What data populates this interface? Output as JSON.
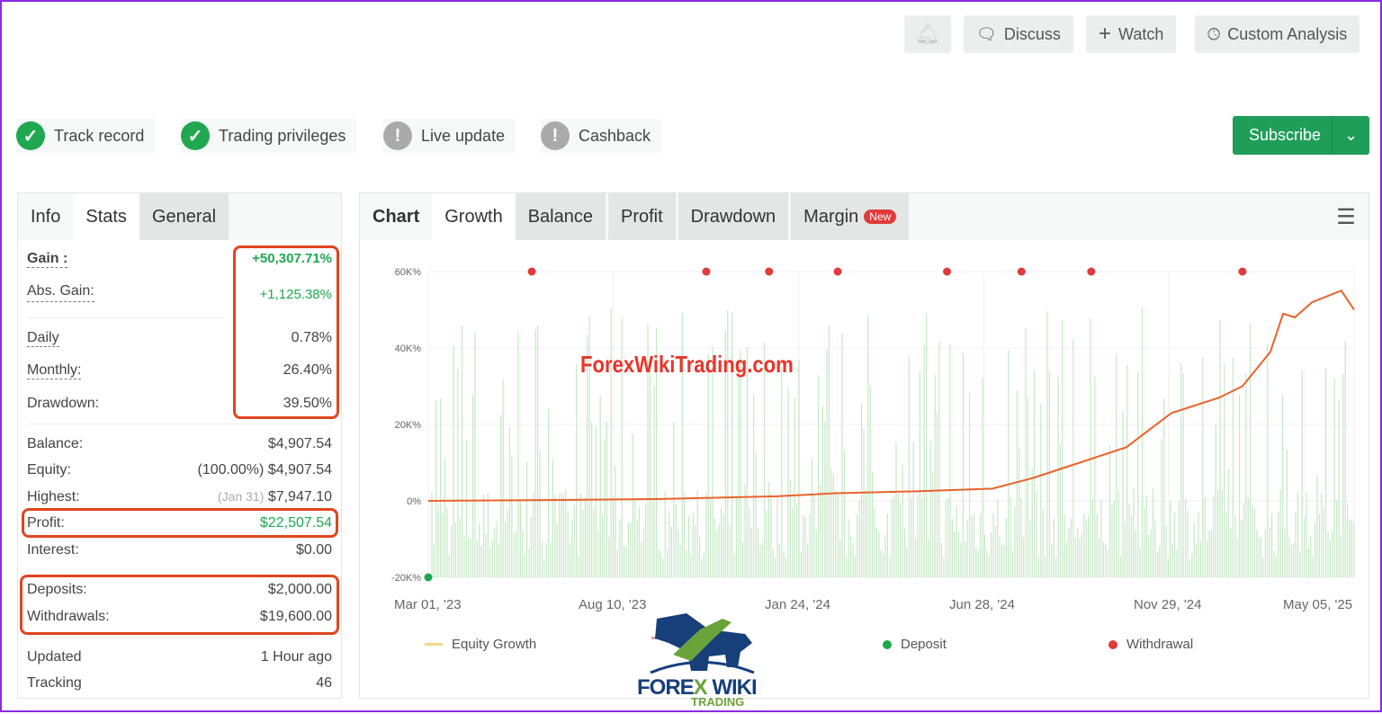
{
  "top_buttons": {
    "notify_icon": "bell-icon",
    "discuss": "Discuss",
    "watch": "Watch",
    "custom": "Custom Analysis"
  },
  "badges": [
    {
      "label": "Track record",
      "status": "ok"
    },
    {
      "label": "Trading privileges",
      "status": "ok"
    },
    {
      "label": "Live update",
      "status": "warn"
    },
    {
      "label": "Cashback",
      "status": "warn"
    }
  ],
  "subscribe": "Subscribe",
  "left_tabs": [
    "Info",
    "Stats",
    "General"
  ],
  "stats": {
    "gain": {
      "label": "Gain :",
      "value": "+50,307.71%"
    },
    "abs_gain": {
      "label": "Abs. Gain:",
      "value": "+1,125.38%"
    },
    "daily": {
      "label": "Daily",
      "value": "0.78%"
    },
    "monthly": {
      "label": "Monthly:",
      "value": "26.40%"
    },
    "drawdown": {
      "label": "Drawdown:",
      "value": "39.50%"
    },
    "balance": {
      "label": "Balance:",
      "value": "$4,907.54"
    },
    "equity": {
      "label": "Equity:",
      "pct": "(100.00%)",
      "value": "$4,907.54"
    },
    "highest": {
      "label": "Highest:",
      "date": "(Jan 31)",
      "value": "$7,947.10"
    },
    "profit": {
      "label": "Profit:",
      "value": "$22,507.54"
    },
    "interest": {
      "label": "Interest:",
      "value": "$0.00"
    },
    "deposits": {
      "label": "Deposits:",
      "value": "$2,000.00"
    },
    "withdrawals": {
      "label": "Withdrawals:",
      "value": "$19,600.00"
    },
    "updated": {
      "label": "Updated",
      "value": "1 Hour ago"
    },
    "tracking": {
      "label": "Tracking",
      "value": "46"
    }
  },
  "chart_tabs": {
    "chart": "Chart",
    "items": [
      "Growth",
      "Balance",
      "Profit",
      "Drawdown",
      "Margin"
    ],
    "new_badge": "New"
  },
  "watermark": "ForexWikiTrading.com",
  "logo_text": "FOREX WIKI TRADING",
  "chart_data": {
    "type": "line",
    "y_ticks": [
      "60K%",
      "40K%",
      "20K%",
      "0%",
      "-20K%"
    ],
    "ylim": [
      -20000,
      60000
    ],
    "x_ticks": [
      "Mar 01, '23",
      "Aug 10, '23",
      "Jan 24, '24",
      "Jun 28, '24",
      "Nov 29, '24",
      "May 05, '25"
    ],
    "x_days_total": 796,
    "equity_growth": [
      [
        0,
        0
      ],
      [
        100,
        200
      ],
      [
        200,
        500
      ],
      [
        300,
        1200
      ],
      [
        350,
        2000
      ],
      [
        420,
        2500
      ],
      [
        485,
        3200
      ],
      [
        520,
        6000
      ],
      [
        550,
        9000
      ],
      [
        600,
        14000
      ],
      [
        639,
        23000
      ],
      [
        680,
        27000
      ],
      [
        700,
        30000
      ],
      [
        724,
        39000
      ],
      [
        735,
        49000
      ],
      [
        745,
        48000
      ],
      [
        760,
        52000
      ],
      [
        785,
        55000
      ],
      [
        796,
        50000
      ]
    ],
    "withdrawal_days": [
      89,
      239,
      293,
      352,
      446,
      510,
      570,
      700
    ],
    "deposit_days": [
      0
    ],
    "legend": [
      "Equity Growth",
      "Deposit",
      "Withdrawal"
    ],
    "colors": {
      "line": "#e8622c",
      "bars": "#b8e3b8",
      "deposit": "#1fa84f",
      "withdrawal": "#e03a3a",
      "legend_equity": "#f2d98a"
    }
  }
}
